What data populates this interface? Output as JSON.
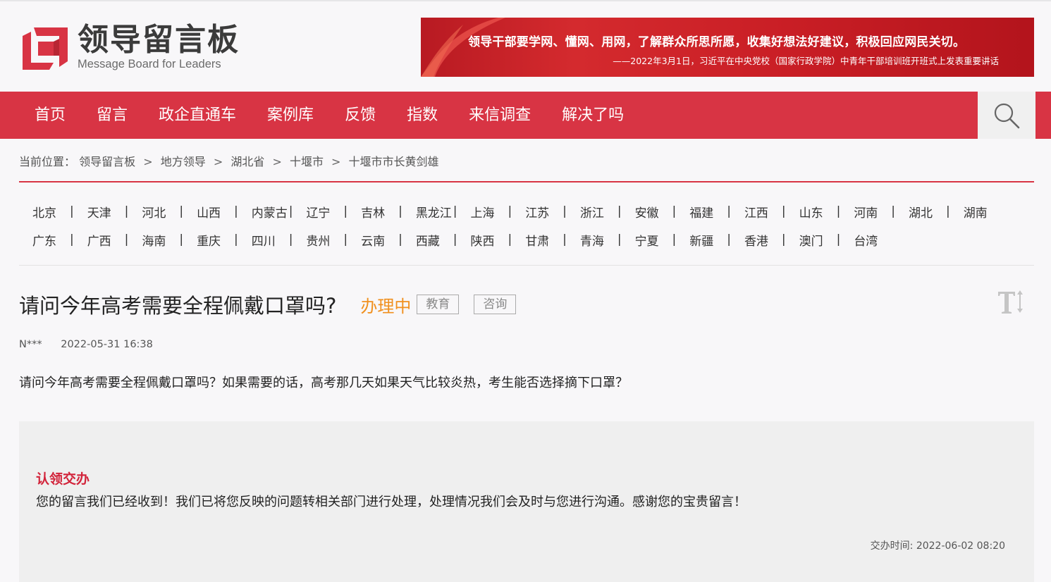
{
  "site": {
    "logo_cn": "领导留言板",
    "logo_en": "Message Board for Leaders"
  },
  "banner": {
    "quote": "领导干部要学网、懂网、用网，了解群众所思所愿，收集好想法好建议，积极回应网民关切。",
    "source": "——2022年3月1日，习近平在中央党校（国家行政学院）中青年干部培训班开班式上发表重要讲话"
  },
  "nav": {
    "items": [
      "首页",
      "留言",
      "政企直通车",
      "案例库",
      "反馈",
      "指数",
      "来信调查",
      "解决了吗"
    ],
    "search_icon": "search-icon"
  },
  "breadcrumb": {
    "prefix": "当前位置：",
    "items": [
      "领导留言板",
      "地方领导",
      "湖北省",
      "十堰市",
      "十堰市市长黄剑雄"
    ],
    "separator": ">"
  },
  "regions": {
    "row1": [
      "北京",
      "天津",
      "河北",
      "山西",
      "内蒙古",
      "辽宁",
      "吉林",
      "黑龙江",
      "上海",
      "江苏",
      "浙江",
      "安徽",
      "福建",
      "江西",
      "山东",
      "河南",
      "湖北",
      "湖南"
    ],
    "row2": [
      "广东",
      "广西",
      "海南",
      "重庆",
      "四川",
      "贵州",
      "云南",
      "西藏",
      "陕西",
      "甘肃",
      "青海",
      "宁夏",
      "新疆",
      "香港",
      "澳门",
      "台湾"
    ],
    "separator": "|"
  },
  "message": {
    "title": "请问今年高考需要全程佩戴口罩吗?",
    "status": "办理中",
    "tags": [
      "教育",
      "咨询"
    ],
    "author": "N***",
    "date": "2022-05-31 16:38",
    "content": "请问今年高考需要全程佩戴口罩吗？如果需要的话，高考那几天如果天气比较炎热，考生能否选择摘下口罩？"
  },
  "reply": {
    "heading": "认领交办",
    "text": "您的留言我们已经收到！我们已将您反映的问题转相关部门进行处理，处理情况我们会及时与您进行沟通。感谢您的宝贵留言！",
    "time": "交办时间: 2022-06-02 08:20"
  },
  "colors": {
    "brand_red": "#d83444",
    "status_orange": "#f0901e",
    "reply_heading": "#d2233a"
  }
}
